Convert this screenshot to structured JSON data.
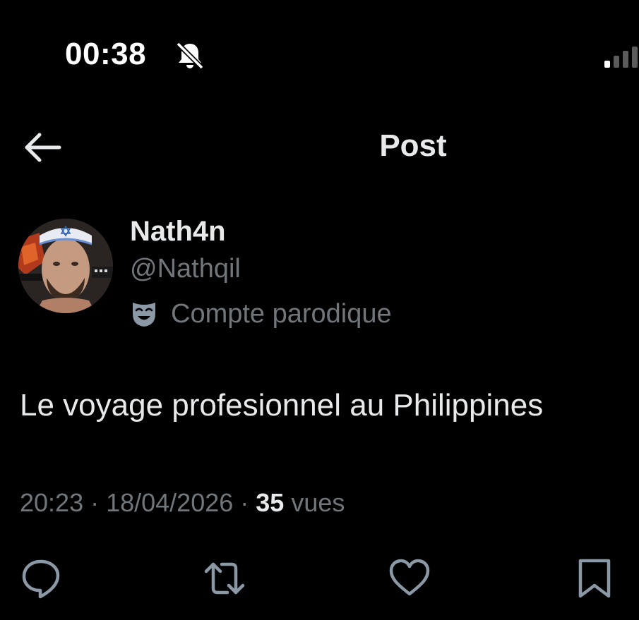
{
  "status_bar": {
    "time": "00:38",
    "silent_icon": "bell-slash-icon",
    "signal_icon": "signal-bars-icon"
  },
  "header": {
    "title": "Post",
    "back_icon": "arrow-left-icon"
  },
  "author": {
    "display_name": "Nath4n",
    "handle": "@Nathqil",
    "label_icon": "theater-mask-icon",
    "label": "Compte parodique"
  },
  "tweet": {
    "text": "Le voyage profesionnel au Philippines"
  },
  "meta": {
    "time": "20:23",
    "sep1": " · ",
    "date": "18/04/2026",
    "sep2": " · ",
    "views_count": "35",
    "views_label": " vues"
  },
  "actions": [
    "reply-icon",
    "repost-icon",
    "like-icon",
    "bookmark-icon"
  ],
  "colors": {
    "background": "#000000",
    "primary_text": "#e7e9ea",
    "secondary_text": "#71767b"
  }
}
